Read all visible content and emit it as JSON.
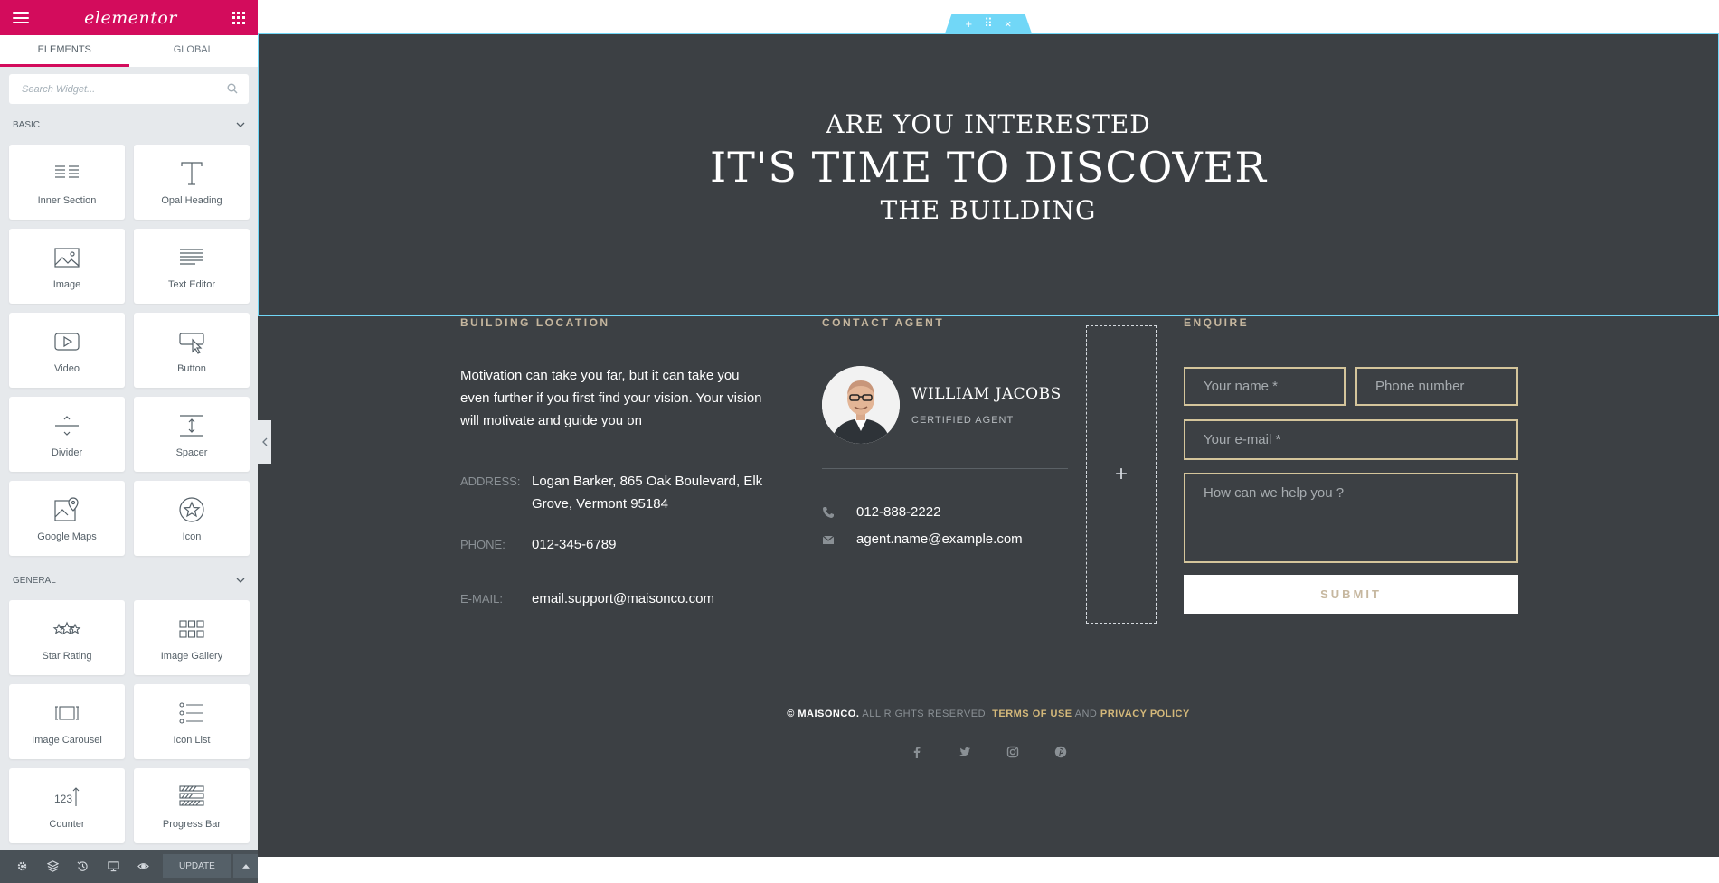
{
  "sidebar": {
    "logo": "elementor",
    "tabs": [
      "ELEMENTS",
      "GLOBAL"
    ],
    "search_placeholder": "Search Widget...",
    "categories": [
      {
        "name": "BASIC",
        "widgets": [
          {
            "label": "Inner Section",
            "icon": "inner-section-icon"
          },
          {
            "label": "Opal Heading",
            "icon": "heading-icon"
          },
          {
            "label": "Image",
            "icon": "image-icon"
          },
          {
            "label": "Text Editor",
            "icon": "text-editor-icon"
          },
          {
            "label": "Video",
            "icon": "video-icon"
          },
          {
            "label": "Button",
            "icon": "button-icon"
          },
          {
            "label": "Divider",
            "icon": "divider-icon"
          },
          {
            "label": "Spacer",
            "icon": "spacer-icon"
          },
          {
            "label": "Google Maps",
            "icon": "google-maps-icon"
          },
          {
            "label": "Icon",
            "icon": "star-icon"
          }
        ]
      },
      {
        "name": "GENERAL",
        "widgets": [
          {
            "label": "Star Rating",
            "icon": "star-rating-icon"
          },
          {
            "label": "Image Gallery",
            "icon": "image-gallery-icon"
          },
          {
            "label": "Image Carousel",
            "icon": "image-carousel-icon"
          },
          {
            "label": "Icon List",
            "icon": "icon-list-icon"
          },
          {
            "label": "Counter",
            "icon": "counter-icon"
          },
          {
            "label": "Progress Bar",
            "icon": "progress-bar-icon"
          }
        ]
      }
    ],
    "bottom": {
      "update_label": "UPDATE"
    }
  },
  "canvas": {
    "hero": {
      "line1": "ARE YOU INTERESTED",
      "line2": "IT'S TIME TO DISCOVER",
      "line3": "THE BUILDING"
    },
    "location": {
      "heading": "BUILDING LOCATION",
      "text": "Motivation can take you far, but it can take you even further if you first find your vision. Your vision will motivate and guide you on",
      "address_label": "ADDRESS:",
      "address_value": "Logan Barker, 865 Oak Boulevard, Elk Grove, Vermont 95184",
      "phone_label": "PHONE:",
      "phone_value": "012-345-6789",
      "email_label": "E-MAIL:",
      "email_value": "email.support@maisonco.com"
    },
    "agent": {
      "heading": "CONTACT AGENT",
      "name": "WILLIAM JACOBS",
      "role": "CERTIFIED AGENT",
      "phone": "012-888-2222",
      "email": "agent.name@example.com"
    },
    "enquire": {
      "heading": "ENQUIRE",
      "name_placeholder": "Your name *",
      "phone_placeholder": "Phone number",
      "email_placeholder": "Your e-mail *",
      "message_placeholder": "How can we help you ?",
      "submit_label": "SUBMIT"
    },
    "footer": {
      "brand": "© MAISONCO.",
      "rights": "ALL RIGHTS RESERVED.",
      "terms": "TERMS OF USE",
      "and": "AND",
      "privacy": "PRIVACY POLICY"
    }
  },
  "colors": {
    "brand": "#d30c5c",
    "dark_bg": "#3c4044",
    "accent_gold": "#c6b79f",
    "editor_blue": "#71d7f7"
  }
}
